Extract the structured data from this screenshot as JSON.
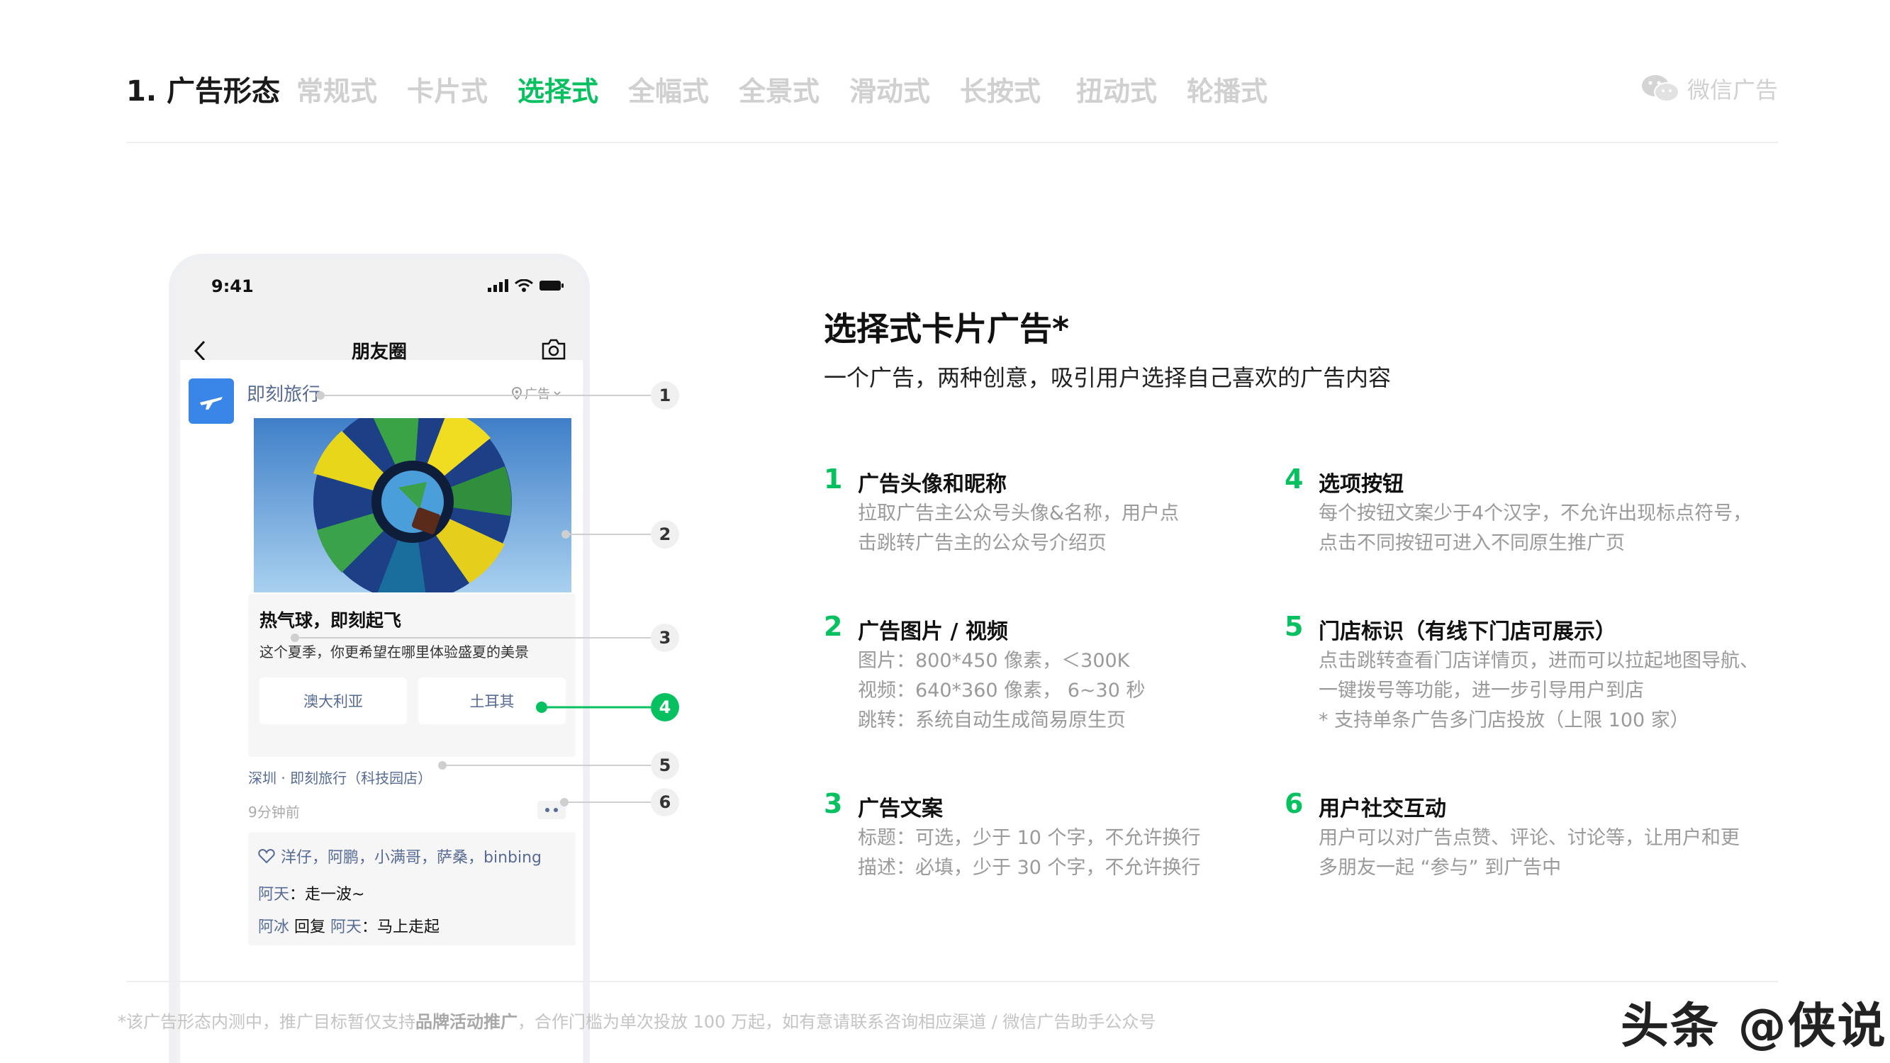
{
  "header": {
    "section_title": "1. 广告形态",
    "tabs": [
      {
        "label": "常规式",
        "active": false
      },
      {
        "label": "卡片式",
        "active": false
      },
      {
        "label": "选择式",
        "active": true
      },
      {
        "label": "全幅式",
        "active": false
      },
      {
        "label": "全景式",
        "active": false
      },
      {
        "label": "滑动式",
        "active": false
      },
      {
        "label": "长按式",
        "active": false
      },
      {
        "label": "扭动式",
        "active": false
      },
      {
        "label": "轮播式",
        "active": false
      }
    ],
    "brand_label": "微信广告",
    "brand_icon": "wechat-icon"
  },
  "phone": {
    "time": "9:41",
    "nav_title": "朋友圈",
    "post": {
      "nickname": "即刻旅行",
      "ad_tag": "广告",
      "headline": "热气球，即刻起飞",
      "description": "这个夏季，你更希望在哪里体验盛夏的美景",
      "options": [
        "澳大利亚",
        "土耳其"
      ],
      "location": "深圳 · 即刻旅行（科技园店）",
      "time_ago": "9分钟前",
      "likes": "洋仔，阿鹏，小满哥，萨桑，binbing",
      "comments": [
        {
          "author": "阿天",
          "reply_to": "",
          "text": "走一波~"
        },
        {
          "author": "阿冰",
          "reply_to": "阿天",
          "text": "马上走起"
        }
      ]
    }
  },
  "callouts": [
    "1",
    "2",
    "3",
    "4",
    "5",
    "6"
  ],
  "main": {
    "title": "选择式卡片广告*",
    "subtitle": "一个广告，两种创意，吸引用户选择自己喜欢的广告内容",
    "features": [
      {
        "num": "1",
        "title": "广告头像和昵称",
        "desc": [
          "拉取广告主公众号头像&名称，用户点",
          "击跳转广告主的公众号介绍页"
        ]
      },
      {
        "num": "2",
        "title": "广告图片 / 视频",
        "desc": [
          "图片：800*450 像素，＜300K",
          "视频：640*360 像素， 6~30 秒",
          "跳转：系统自动生成简易原生页"
        ]
      },
      {
        "num": "3",
        "title": "广告文案",
        "desc": [
          "标题：可选，少于 10 个字，不允许换行",
          "描述：必填，少于 30 个字，不允许换行"
        ]
      },
      {
        "num": "4",
        "title": "选项按钮",
        "desc": [
          "每个按钮文案少于4个汉字，不允许出现标点符号，",
          "点击不同按钮可进入不同原生推广页"
        ]
      },
      {
        "num": "5",
        "title": "门店标识（有线下门店可展示）",
        "desc": [
          "点击跳转查看门店详情页，进而可以拉起地图导航、",
          "一键拨号等功能，进一步引导用户到店",
          "* 支持单条广告多门店投放（上限 100 家）"
        ]
      },
      {
        "num": "6",
        "title": "用户社交互动",
        "desc": [
          "用户可以对广告点赞、评论、讨论等，让用户和更",
          "多朋友一起 “参与” 到广告中"
        ]
      }
    ]
  },
  "footer": {
    "note_prefix": "*该广告形态内测中，推广目标暂仅支持",
    "note_bold": "品牌活动推广",
    "note_suffix": "，合作门槛为单次投放 100 万起，如有意请联系咨询相应渠道 / 微信广告助手公众号",
    "watermark": "头条 @侠说"
  },
  "colors": {
    "accent": "#07c160",
    "link": "#576b95",
    "muted": "#9a9a9a",
    "inactive_tab": "#d0d0d0"
  }
}
